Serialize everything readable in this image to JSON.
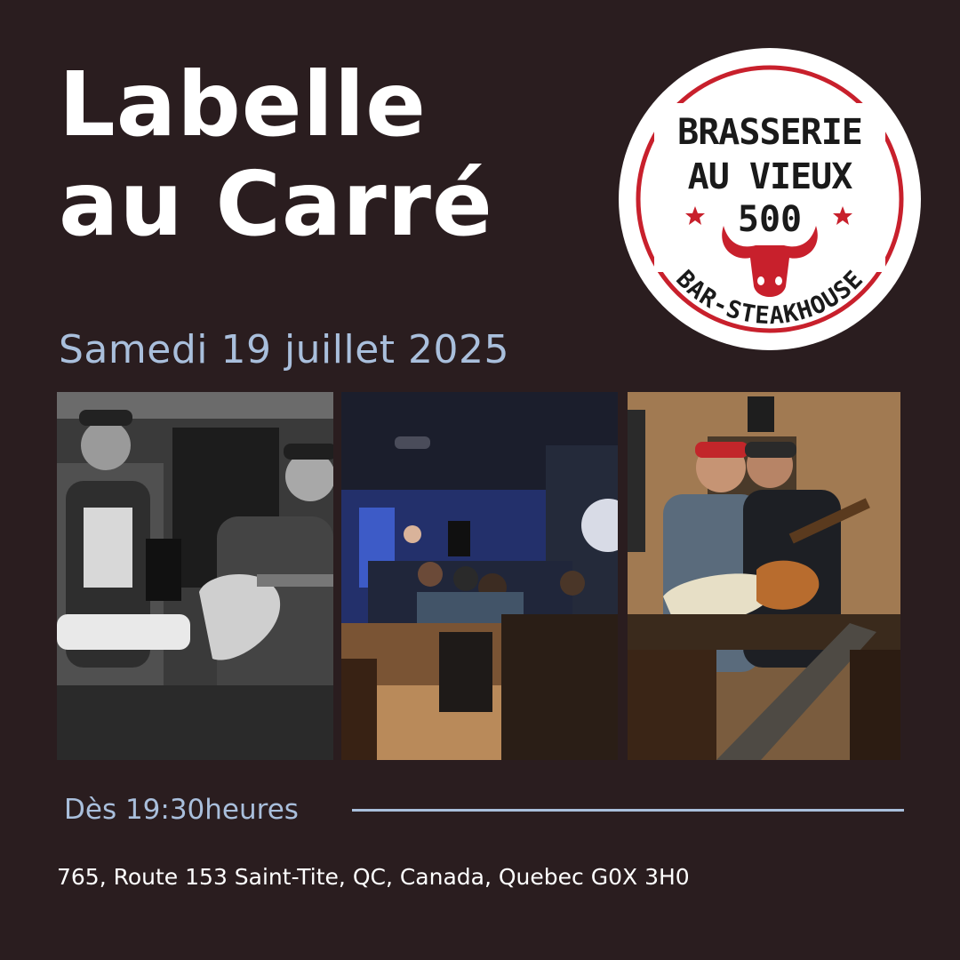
{
  "event": {
    "title_line1": "Labelle",
    "title_line2": "au Carré",
    "date": "Samedi 19 juillet 2025",
    "time": "Dès 19:30heures",
    "address": "765, Route 153 Saint-Tite, QC, Canada, Quebec G0X 3H0"
  },
  "logo": {
    "line1": "BRASSERIE",
    "line2": "AU VIEUX",
    "line3": "500",
    "ring_text": "BAR-STEAKHOUSE",
    "accent_color": "#c8202c"
  },
  "colors": {
    "background": "#2a1d1f",
    "accent_blue": "#a9bfdc"
  }
}
